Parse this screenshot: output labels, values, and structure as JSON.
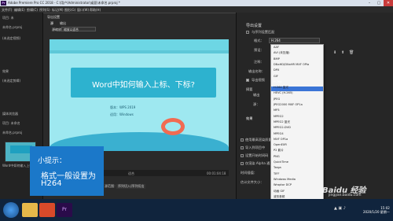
{
  "window": {
    "title": "Adobe Premiere Pro CC 2018 - C:\\用户\\Administrator\\桌面\\未命名.prproj *",
    "logo": "Pr"
  },
  "menu": [
    "文件(F)",
    "编辑(E)",
    "剪辑(C)",
    "序列(S)",
    "标记(M)",
    "图形(G)",
    "窗口(W)",
    "帮助(H)"
  ],
  "left_panel": {
    "items": [
      "项目: 未",
      "未命名.prproj",
      "(未选定视频)",
      "效果",
      "(未选定剪辑)",
      "媒体浏览器",
      "项目: 未命名",
      "未命名.prproj",
      "Word中如何输入上标 pptx"
    ]
  },
  "dialog": {
    "tabs": [
      "导出设置",
      "源",
      "输出"
    ],
    "source_scaling_label": "源缩放",
    "source_scaling_value": "缩放以适合"
  },
  "slide": {
    "title": "Word中如何输入上标、下标?",
    "line1": "版本：WPS 2019",
    "line2": "适用：Windows"
  },
  "timeline": {
    "start": "00:00:00:00",
    "fit_label": "适合",
    "end": "00:01:04:18",
    "range_label": "源范围：",
    "range_value": "序列切入/序列切出"
  },
  "tip": {
    "title": "小提示：",
    "line1": "格式一般设置为",
    "line2": "H264"
  },
  "export_settings": {
    "header": "导出设置",
    "match_sequence": "与序列设置匹配",
    "format_label": "格式：",
    "format_value": "H.264",
    "preset_label": "预设：",
    "comment_label": "注释：",
    "output_label": "输出名称：",
    "export_video": "导出视频",
    "export_audio": "导出音频",
    "summary_label": "摘要",
    "output_short": "输出",
    "source_short": "源：",
    "effects_tab": "效果",
    "use_max_render": "使用最高渲染质量",
    "use_previews": "使用预览",
    "import_project": "导入到项目中",
    "set_start_timecode": "设置开始时间码",
    "render_alpha": "仅渲染 Alpha 通道",
    "time_interpolation": "时间插值：",
    "estimated_size": "估计文件大小："
  },
  "format_dropdown": {
    "selected": "H.264",
    "items": [
      "AAF",
      "AVI (未压缩)",
      "BMP",
      "DNxHD/DNxHR MXF OPIa",
      "DPX",
      "GIF",
      "H.264",
      "H.264 蓝光",
      "HEVC (H.265)",
      "JPEG",
      "JPEG2000 MXF OP1a",
      "MP3",
      "MPEG2",
      "MPEG2 蓝光",
      "MPEG2-DVD",
      "MPEG4",
      "MXF OP1a",
      "OpenEXR",
      "P2 影片",
      "PNG",
      "QuickTime",
      "Targa",
      "TIFF",
      "Windows Media",
      "Wraptor DCP",
      "动画 GIF",
      "波形音频"
    ]
  },
  "taskbar": {
    "time": "15:02",
    "date": "2020/1/20 星期一"
  },
  "watermark": {
    "brand": "Baidu 经验",
    "url": "jingyan.baidu.com"
  },
  "colors": {
    "tip_bg": "#1b78c9",
    "slide_header": "#2db2cf",
    "dropdown_selected": "#3a74d6",
    "premiere_purple": "#2a0b4a"
  }
}
